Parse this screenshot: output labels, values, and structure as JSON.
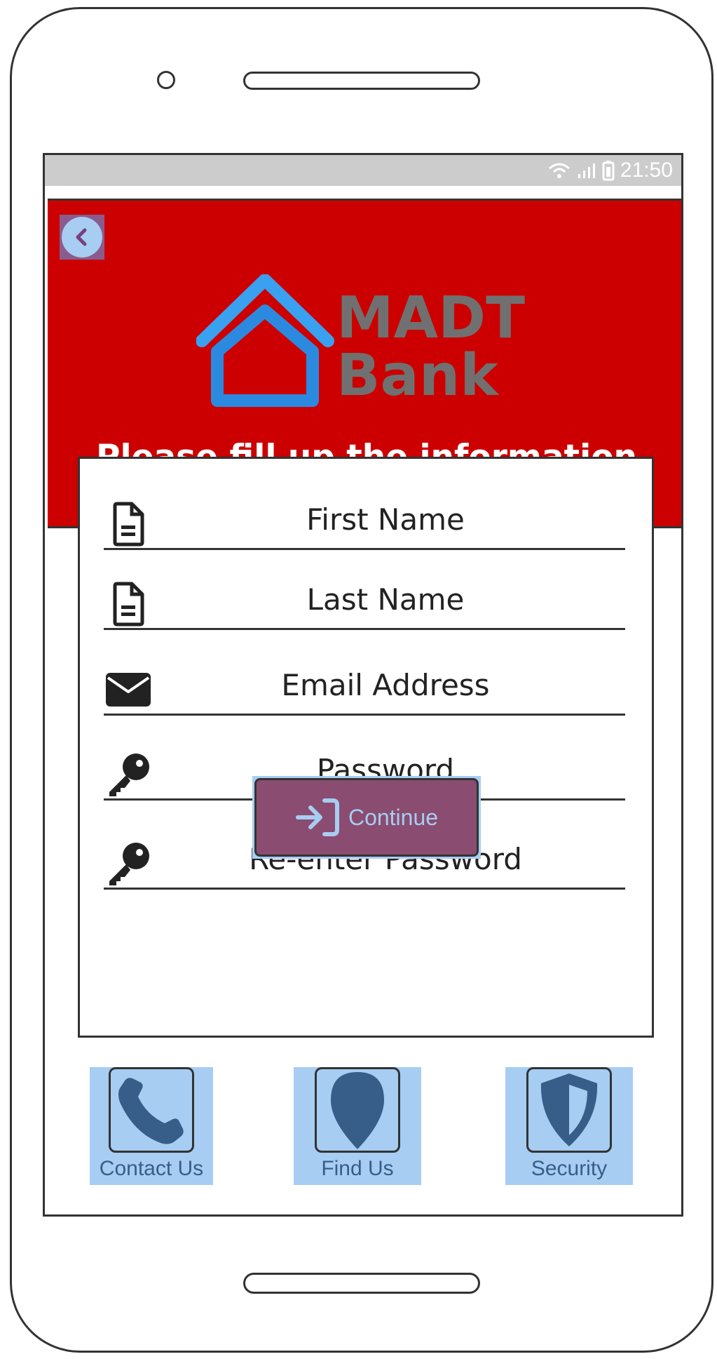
{
  "status_bar": {
    "time": "21:50",
    "wifi_icon": "wifi-icon",
    "signal_icon": "signal-icon",
    "battery_icon": "battery-icon"
  },
  "header": {
    "back_icon": "chevron-left-icon",
    "logo_line1": "MADT",
    "logo_line2": "Bank",
    "title": "Please fill up the information"
  },
  "form": {
    "fields": [
      {
        "label": "First Name",
        "icon": "document-icon"
      },
      {
        "label": "Last Name",
        "icon": "document-icon"
      },
      {
        "label": "Email Address",
        "icon": "envelope-icon"
      },
      {
        "label": "Password",
        "icon": "key-icon"
      },
      {
        "label": "Re-enter Password",
        "icon": "key-icon"
      }
    ],
    "continue_label": "Continue",
    "continue_icon": "sign-in-icon"
  },
  "bottom_nav": [
    {
      "label": "Contact Us",
      "icon": "phone-icon"
    },
    {
      "label": "Find Us",
      "icon": "map-pin-icon"
    },
    {
      "label": "Security",
      "icon": "shield-icon"
    }
  ],
  "colors": {
    "header_red": "#cc0000",
    "button_purple": "#8a4c70",
    "highlight_blue": "#a7cdf2",
    "icon_dark_blue": "#365e88",
    "logo_blue": "#2196f3",
    "logo_gray": "#707070"
  }
}
